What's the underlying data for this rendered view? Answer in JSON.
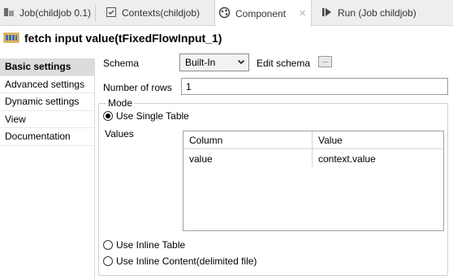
{
  "tabs": [
    {
      "label": "Job(childjob 0.1)",
      "icon": "job-icon"
    },
    {
      "label": "Contexts(childjob)",
      "icon": "contexts-icon"
    },
    {
      "label": "Component",
      "icon": "component-icon",
      "active": true
    },
    {
      "label": "Run (Job childjob)",
      "icon": "run-icon"
    }
  ],
  "header": {
    "title": "fetch input value(tFixedFlowInput_1)",
    "icon": "tfixedflowinput-icon"
  },
  "sidebar": {
    "items": [
      {
        "label": "Basic settings",
        "selected": true
      },
      {
        "label": "Advanced settings"
      },
      {
        "label": "Dynamic settings"
      },
      {
        "label": "View"
      },
      {
        "label": "Documentation"
      }
    ]
  },
  "basic": {
    "schema_label": "Schema",
    "schema_value": "Built-In",
    "edit_schema_label": "Edit schema",
    "edit_schema_button": "...",
    "rows_label": "Number of rows",
    "rows_value": "1",
    "mode_label": "Mode",
    "use_single_table": "Use Single Table",
    "values_label": "Values",
    "table": {
      "columns": [
        "Column",
        "Value"
      ],
      "rows": [
        [
          "value",
          "context.value"
        ]
      ]
    },
    "use_inline_table": "Use Inline Table",
    "use_inline_content": "Use Inline Content(delimited file)"
  },
  "colors": {
    "selected_nav": "#dcdcdc",
    "tab_bg": "#eeeeee"
  }
}
